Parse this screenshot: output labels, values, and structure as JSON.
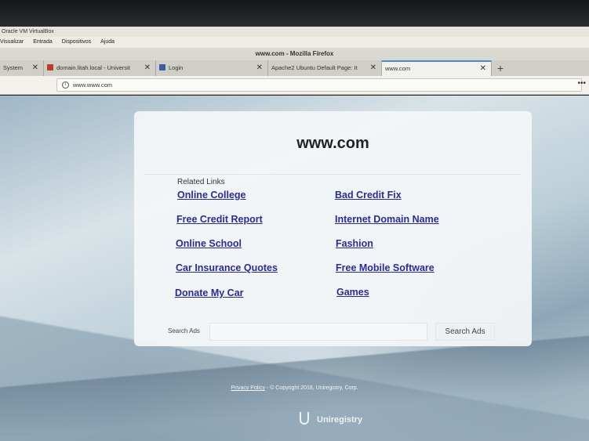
{
  "virtualbox": {
    "title": "Oracle VM VirtualBox",
    "menu": [
      "Visualizar",
      "Entrada",
      "Dispositivos",
      "Ajuda"
    ]
  },
  "firefox": {
    "window_title": "www.com - Mozilla Firefox",
    "tabs": [
      {
        "label": "System",
        "favicon_color": "#888888"
      },
      {
        "label": "domain.litah.local - Universit",
        "favicon_color": "#c0392b"
      },
      {
        "label": "Login",
        "favicon_color": "#3b5ba5"
      },
      {
        "label": "Apache2 Ubuntu Default Page: It",
        "favicon_color": "#cfcec7"
      },
      {
        "label": "www.com",
        "favicon_color": "#f2f1ec"
      }
    ],
    "new_tab_symbol": "+",
    "close_symbol": "✕",
    "url": "www.www.com",
    "info_symbol": "i",
    "menu_symbol": "•••"
  },
  "page": {
    "site_title": "www.com",
    "related_label": "Related Links",
    "links": [
      "Online College",
      "Bad Credit Fix",
      "Free Credit Report",
      "Internet Domain Name",
      "Online School",
      "Fashion",
      "Car Insurance Quotes",
      "Free Mobile Software",
      "Donate My Car",
      "Games"
    ],
    "search_label": "Search Ads",
    "search_button": "Search Ads",
    "footer": {
      "privacy": "Privacy Policy",
      "copyright": "- © Copyright 2018, Uniregistry, Corp."
    },
    "brand": "Uniregistry"
  },
  "colors": {
    "link": "#2a2aa0",
    "active_tab_accent": "#4a89dc"
  }
}
